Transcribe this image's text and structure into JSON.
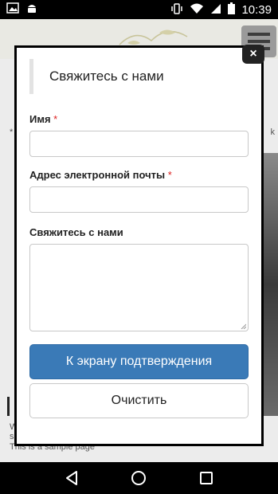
{
  "status_bar": {
    "time": "10:39",
    "icons": [
      "image-icon",
      "android-icon",
      "vibrate-icon",
      "wifi-icon",
      "signal-icon",
      "battery-icon"
    ]
  },
  "background_page": {
    "text_star": "*",
    "text_k": "k",
    "line1": "W",
    "line2": "s",
    "sample_text": "This is a sample page"
  },
  "modal": {
    "title": "Свяжитесь с нами",
    "close_label": "×",
    "fields": {
      "name": {
        "label": "Имя",
        "required_mark": "*",
        "value": ""
      },
      "email": {
        "label": "Адрес электронной почты",
        "required_mark": "*",
        "value": ""
      },
      "message": {
        "label": "Свяжитесь с нами",
        "value": ""
      }
    },
    "confirm_button": "К экрану подтверждения",
    "clear_button": "Очистить"
  },
  "nav_bar": {
    "icons": [
      "back-icon",
      "home-icon",
      "recents-icon"
    ]
  },
  "colors": {
    "primary_button": "#3a7ab7",
    "required": "#dd2222"
  }
}
